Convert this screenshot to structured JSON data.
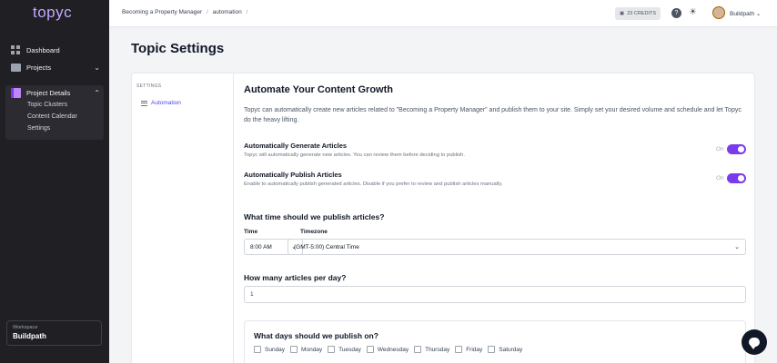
{
  "app": {
    "logo": "topyc"
  },
  "sidebar": {
    "items": [
      {
        "label": "Dashboard"
      },
      {
        "label": "Projects",
        "chevron": "⌄"
      },
      {
        "label": "Project Details",
        "chevron": "⌃"
      }
    ],
    "sub_items": [
      "Topic Clusters",
      "Content Calendar",
      "Settings"
    ],
    "workspace": {
      "label": "Workspace",
      "value": "Buildpath"
    }
  },
  "topbar": {
    "breadcrumb": [
      "Becoming a Property Manager",
      "automation",
      ""
    ],
    "credits": "23 CREDITS",
    "help": "?",
    "theme_icon": "☀",
    "user": "Buildpath ⌄"
  },
  "page": {
    "title": "Topic Settings"
  },
  "settings_nav": {
    "section_label": "SETTINGS",
    "item": "Automation"
  },
  "main": {
    "heading": "Automate Your Content Growth",
    "description": "Topyc can automatically create new articles related to \"Becoming a Property Manager\" and publish them to your site. Simply set your desired volume and schedule and let Topyc do the heavy lifting.",
    "options": [
      {
        "title": "Automatically Generate Articles",
        "desc": "Topyc will automatically generate new articles. You can review them before deciding to publish.",
        "state": "On",
        "enabled": true
      },
      {
        "title": "Automatically Publish Articles",
        "desc": "Enable to automatically publish generated articles. Disable if you prefer to review and publish articles manually.",
        "state": "On",
        "enabled": true
      }
    ],
    "publish_time": {
      "heading": "What time should we publish articles?",
      "time_label": "Time",
      "time_value": "8:00 AM",
      "timezone_label": "Timezone",
      "timezone_value": "(GMT-5:00) Central Time"
    },
    "per_day": {
      "heading": "How many articles per day?",
      "value": "1"
    },
    "days": {
      "heading": "What days should we publish on?",
      "list": [
        "Sunday",
        "Monday",
        "Tuesday",
        "Wednesday",
        "Thursday",
        "Friday",
        "Saturday"
      ]
    }
  },
  "colors": {
    "accent": "#7c3aed",
    "sidebar_bg": "#1f1f24",
    "link": "#4f46e5"
  }
}
